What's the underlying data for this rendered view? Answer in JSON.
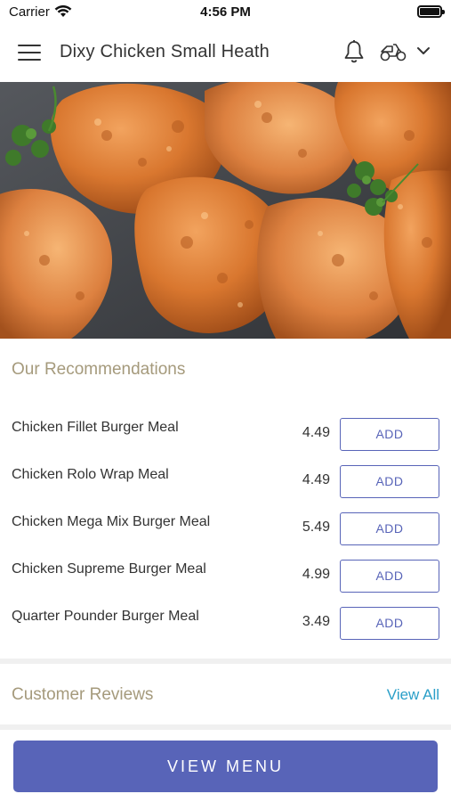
{
  "status_bar": {
    "carrier": "Carrier",
    "time": "4:56 PM"
  },
  "header": {
    "title": "Dixy Chicken Small Heath",
    "icons": [
      "menu-icon",
      "bell-icon",
      "scooter-icon",
      "chevron-down-icon"
    ]
  },
  "hero": {
    "image": "fried-chicken-photo"
  },
  "recommendations": {
    "title": "Our Recommendations",
    "items": [
      {
        "name": "Chicken Fillet Burger Meal",
        "price": "4.49",
        "button": "ADD"
      },
      {
        "name": "Chicken Rolo Wrap Meal",
        "price": "4.49",
        "button": "ADD"
      },
      {
        "name": "Chicken Mega Mix Burger Meal",
        "price": "5.49",
        "button": "ADD"
      },
      {
        "name": "Chicken Supreme Burger Meal",
        "price": "4.99",
        "button": "ADD"
      },
      {
        "name": "Quarter Pounder Burger Meal",
        "price": "3.49",
        "button": "ADD"
      }
    ]
  },
  "reviews": {
    "title": "Customer Reviews",
    "view_all": "View All"
  },
  "footer": {
    "view_menu": "VIEW MENU"
  },
  "colors": {
    "accent": "#5864b8",
    "section_title": "#a59a7c",
    "link": "#2a9fc8"
  }
}
